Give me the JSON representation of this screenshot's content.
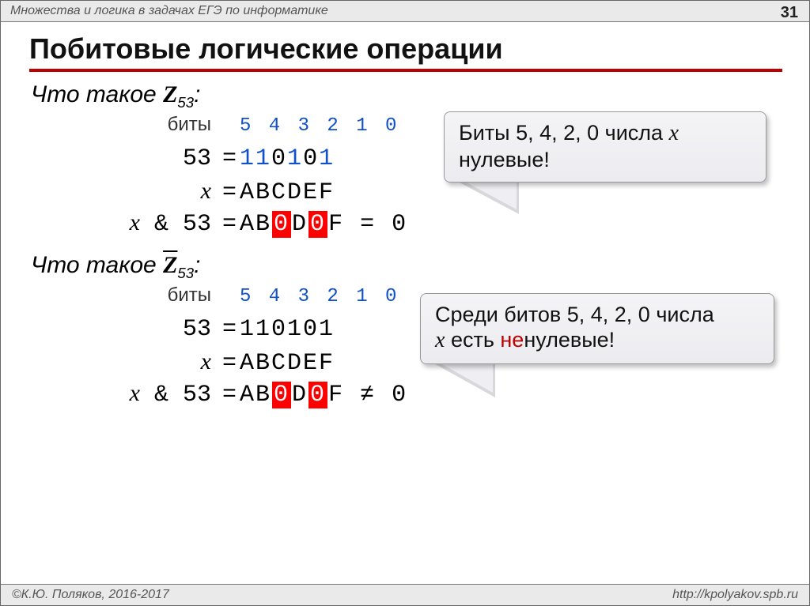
{
  "header": {
    "breadcrumb": "Множества и логика в задачах ЕГЭ по информатике",
    "page": "31"
  },
  "title": "Побитовые логические операции",
  "block1": {
    "question_prefix": "Что такое ",
    "symbol": "Z",
    "subscript": "53",
    "question_suffix": ":",
    "bits_label": "биты",
    "bits_digits": "5 4 3 2 1 0",
    "row1_lhs": "53",
    "row1_rhs_a": "1",
    "row1_rhs_b": "1",
    "row1_rhs_c": "0",
    "row1_rhs_d": "1",
    "row1_rhs_e": "0",
    "row1_rhs_f": "1",
    "row2_lhs": "x",
    "row2_rhs": "ABCDEF",
    "row3_lhs_a": "x",
    "row3_lhs_b": " & 53",
    "row3_rhs_a": "AB",
    "row3_rhs_b": "0",
    "row3_rhs_c": "D",
    "row3_rhs_d": "0",
    "row3_rhs_e": "F",
    "row3_tail": " = 0"
  },
  "callout1": {
    "line1a": "Биты 5, 4, 2, 0 числа ",
    "line1b": "x",
    "line2": "нулевые!"
  },
  "block2": {
    "question_prefix": "Что такое ",
    "symbol": "Z",
    "subscript": "53",
    "question_suffix": ":",
    "bits_label": "биты",
    "bits_digits": "5 4 3 2 1 0",
    "row1_lhs": "53",
    "row1_rhs": "110101",
    "row2_lhs": "x",
    "row2_rhs": "ABCDEF",
    "row3_lhs_a": "x",
    "row3_lhs_b": " & 53",
    "row3_rhs_a": "AB",
    "row3_rhs_b": "0",
    "row3_rhs_c": "D",
    "row3_rhs_d": "0",
    "row3_rhs_e": "F",
    "row3_tail": " ≠ 0"
  },
  "callout2": {
    "line1": "Среди битов 5, 4, 2, 0 числа",
    "line2a": "x",
    "line2b": " есть ",
    "line2c": "не",
    "line2d": "нулевые!"
  },
  "footer": {
    "left": "©К.Ю. Поляков, 2016-2017",
    "right": "http://kpolyakov.spb.ru"
  }
}
